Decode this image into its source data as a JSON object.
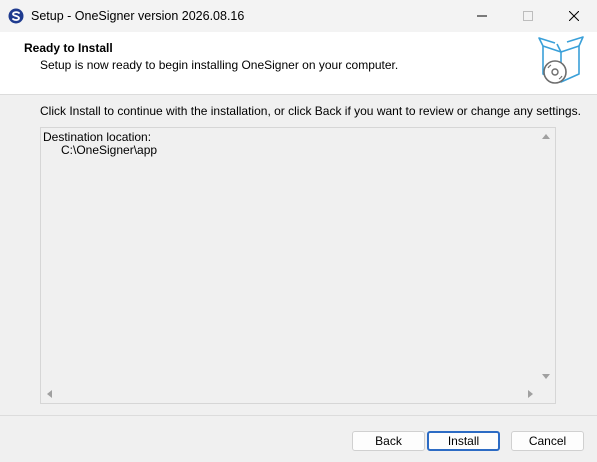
{
  "window": {
    "title": "Setup - OneSigner version 2026.08.16",
    "icon": "onesigner-app-icon",
    "controls": [
      "minimize-icon",
      "maximize-icon",
      "close-icon"
    ]
  },
  "header": {
    "title": "Ready to Install",
    "subtitle": "Setup is now ready to begin installing OneSigner on your computer.",
    "graphic": "box-with-disc-icon"
  },
  "body": {
    "intro": "Click Install to continue with the installation, or click Back if you want to review or change any settings.",
    "memo": {
      "label": "Destination location:",
      "value": "C:\\OneSigner\\app"
    }
  },
  "buttons": {
    "back": "Back",
    "install": "Install",
    "cancel": "Cancel"
  },
  "colors": {
    "accent": "#2c6bc4",
    "graphic": "#3aa0d9"
  }
}
